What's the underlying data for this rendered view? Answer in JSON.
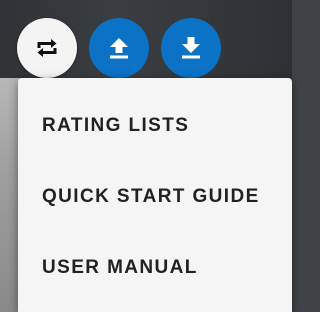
{
  "toolbar": {
    "buttons": [
      {
        "icon": "swap-arrows-icon",
        "color": "#f4f4f4"
      },
      {
        "icon": "upload-icon",
        "color": "#0b72c5"
      },
      {
        "icon": "download-icon",
        "color": "#0b72c5"
      }
    ]
  },
  "menu": {
    "items": [
      {
        "label": "RATING LISTS"
      },
      {
        "label": "QUICK START GUIDE"
      },
      {
        "label": "USER MANUAL"
      }
    ]
  },
  "colors": {
    "accent": "#0b72c5",
    "menu_background": "#f5f5f5",
    "menu_text": "#222222",
    "backdrop": "#3f4347"
  }
}
